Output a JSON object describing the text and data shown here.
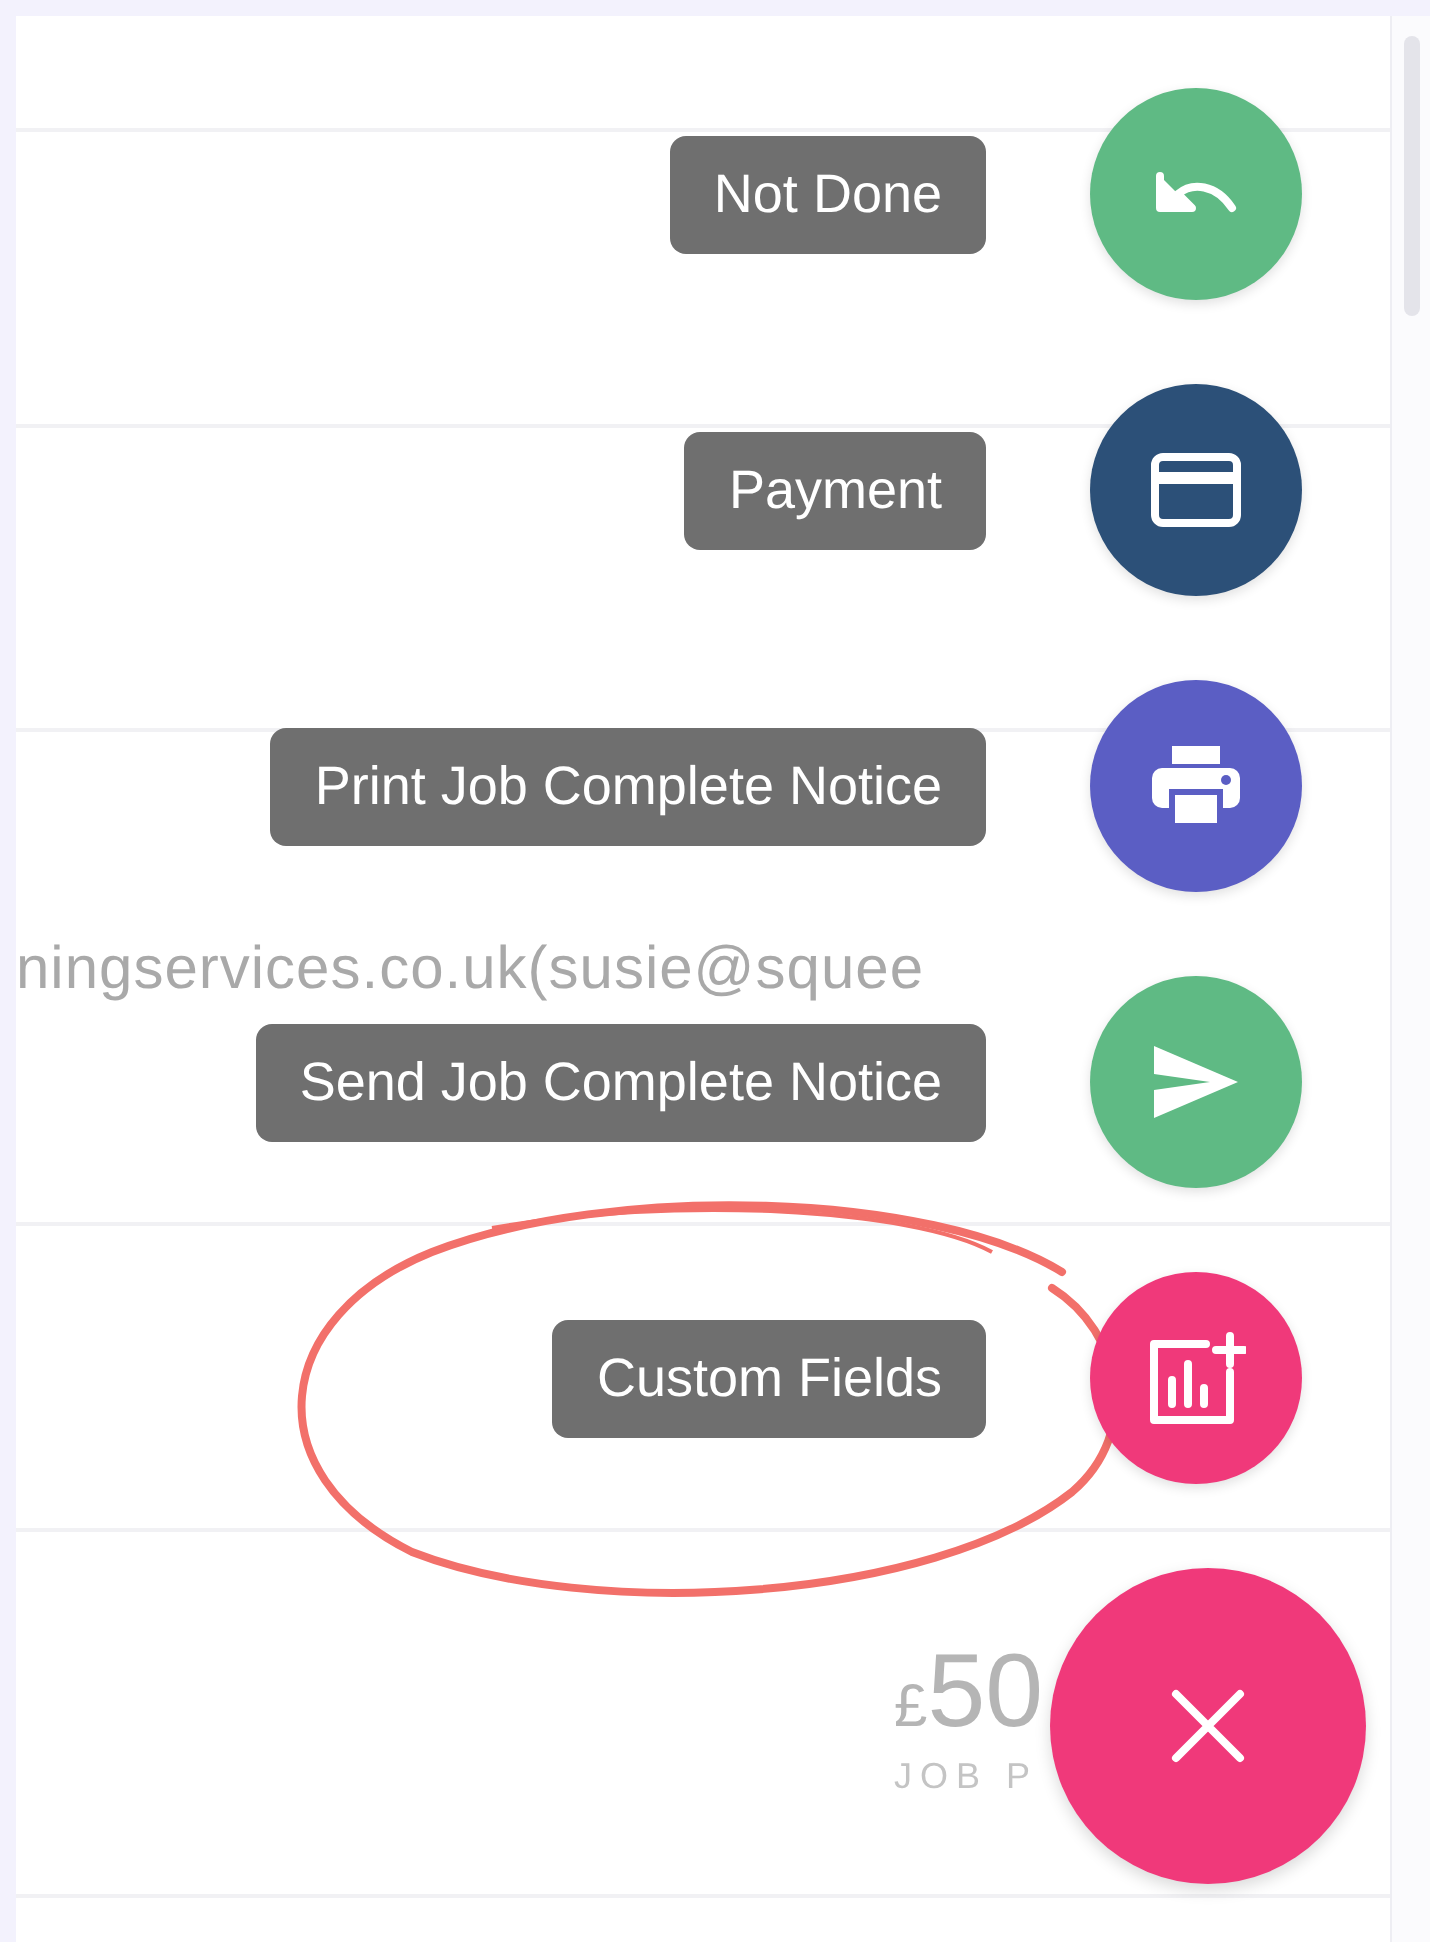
{
  "background": {
    "email_line": "ningservices.co.uk(susie@squee",
    "price": {
      "currency": "£",
      "amount": "50",
      "caption": "JOB P"
    }
  },
  "speed_dial": {
    "actions": [
      {
        "label": "Not Done",
        "kind": "undo",
        "color": "#5fba84"
      },
      {
        "label": "Payment",
        "kind": "card",
        "color": "#2c5078"
      },
      {
        "label": "Print Job Complete Notice",
        "kind": "print",
        "color": "#5b5ec4"
      },
      {
        "label": "Send Job Complete Notice",
        "kind": "send",
        "color": "#5fba84"
      },
      {
        "label": "Custom Fields",
        "kind": "chart-add",
        "color": "#f0397a"
      }
    ]
  }
}
